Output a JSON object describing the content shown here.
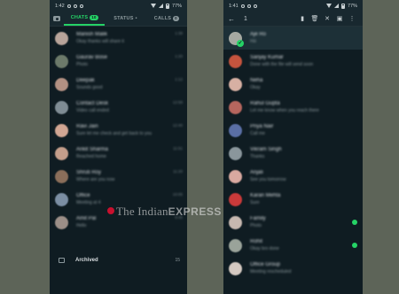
{
  "left": {
    "status": {
      "time": "1:42",
      "battery": "77%"
    },
    "tabs": [
      {
        "label": "CHATS",
        "badge": "10"
      },
      {
        "label": "STATUS",
        "badge": "•"
      },
      {
        "label": "CALLS",
        "badge": "0"
      }
    ],
    "chats": [
      {
        "name": "Manish Malik",
        "preview": "Okay thanks will share it",
        "time": "1:38",
        "color": "#b8a49a"
      },
      {
        "name": "Gaurav Bose",
        "preview": "Photo",
        "time": "1:20",
        "color": "#6c7a6a"
      },
      {
        "name": "Deepak",
        "preview": "Sounds good",
        "time": "1:12",
        "color": "#b39183"
      },
      {
        "name": "Contact Desk",
        "preview": "Video call ended",
        "time": "12:58",
        "color": "#7f8c94"
      },
      {
        "name": "Ravi Jain",
        "preview": "Sure let me check and get back to you",
        "time": "12:40",
        "color": "#d1a693"
      },
      {
        "name": "Ankit Sharma",
        "preview": "Reached home",
        "time": "11:51",
        "color": "#c49e8b"
      },
      {
        "name": "Shruti Roy",
        "preview": "Where are you now",
        "time": "11:20",
        "color": "#8a6e5a"
      },
      {
        "name": "Office",
        "preview": "Meeting at 4",
        "time": "10:05",
        "color": "#7b8ea3"
      },
      {
        "name": "Amit Pal",
        "preview": "Hello",
        "time": "9:45",
        "color": "#9c8f88"
      }
    ],
    "archived_label": "Archived",
    "archived_count": "15"
  },
  "right": {
    "status": {
      "time": "1:41",
      "battery": "77%"
    },
    "selected_count": "1",
    "chats": [
      {
        "name": "Aje Ro",
        "preview": "Hiii",
        "time": "",
        "color": "#a6a9a2",
        "selected": true
      },
      {
        "name": "Sanjay Kumar",
        "preview": "Done with the file will send soon",
        "time": "",
        "color": "#c5543e"
      },
      {
        "name": "Neha",
        "preview": "Okay",
        "time": "",
        "color": "#d7b0a3"
      },
      {
        "name": "Rahul Gupta",
        "preview": "Let me know when you reach there",
        "time": "",
        "color": "#b6665e"
      },
      {
        "name": "Priya Nair",
        "preview": "Call me",
        "time": "",
        "color": "#5a6fa5"
      },
      {
        "name": "Vikram Singh",
        "preview": "Thanks",
        "time": "",
        "color": "#8a969c"
      },
      {
        "name": "Anjali",
        "preview": "See you tomorrow",
        "time": "",
        "color": "#d9a9a0"
      },
      {
        "name": "Karan Mehta",
        "preview": "Sure",
        "time": "",
        "color": "#ca3a3a"
      },
      {
        "name": "Family",
        "preview": "Photo",
        "time": "",
        "color": "#c7b8b0",
        "unread": true
      },
      {
        "name": "Rohit",
        "preview": "Okay bro done",
        "time": "",
        "color": "#9aa39a",
        "unread": true
      },
      {
        "name": "Office Group",
        "preview": "Meeting rescheduled",
        "time": "",
        "color": "#d4c9c1"
      }
    ]
  },
  "watermark": {
    "brand": "The Indian",
    "brand_bold": "EXPRESS"
  },
  "colors": {
    "accent": "#25d366",
    "fab": "#00af9c",
    "background": "#0f1c22",
    "header": "#18282f"
  }
}
